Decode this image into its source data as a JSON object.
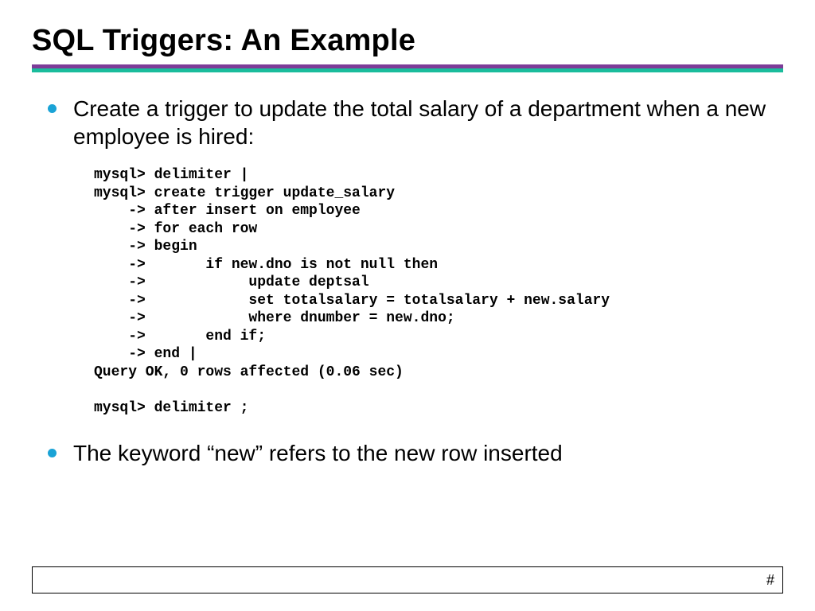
{
  "title": "SQL Triggers: An Example",
  "bullets": {
    "b1": "Create a trigger to update the total salary of a department when a new employee is hired:",
    "b2": "The keyword “new” refers to the new row inserted"
  },
  "code_lines": "mysql> delimiter |\nmysql> create trigger update_salary\n    -> after insert on employee\n    -> for each row\n    -> begin\n    ->       if new.dno is not null then\n    ->            update deptsal\n    ->            set totalsalary = totalsalary + new.salary\n    ->            where dnumber = new.dno;\n    ->       end if;\n    -> end |\nQuery OK, 0 rows affected (0.06 sec)\n\nmysql> delimiter ;",
  "footer": {
    "page": "#"
  }
}
